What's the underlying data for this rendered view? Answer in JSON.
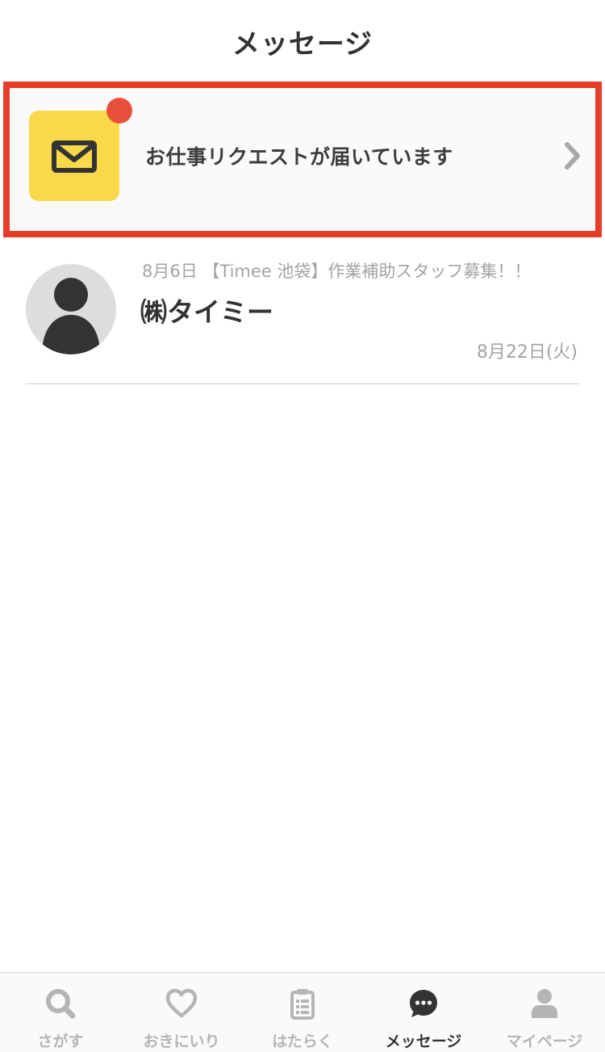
{
  "header": {
    "title": "メッセージ"
  },
  "request_banner": {
    "text": "お仕事リクエストが届いています",
    "has_notification": true,
    "icon": "mail-icon",
    "tile_color": "#f9d84a",
    "dot_color": "#e8503c",
    "highlight_border_color": "#e53d27"
  },
  "threads": [
    {
      "preview": "8月6日 【Timee 池袋】作業補助スタッフ募集！！",
      "sender": "㈱タイミー",
      "date": "8月22日(火)",
      "avatar": "person-avatar-icon"
    }
  ],
  "tabbar": {
    "tabs": [
      {
        "label": "さがす",
        "icon": "search-icon",
        "active": false
      },
      {
        "label": "おきにいり",
        "icon": "heart-icon",
        "active": false
      },
      {
        "label": "はたらく",
        "icon": "clipboard-icon",
        "active": false
      },
      {
        "label": "メッセージ",
        "icon": "chat-bubble-icon",
        "active": true
      },
      {
        "label": "マイページ",
        "icon": "user-icon",
        "active": false
      }
    ],
    "inactive_color": "#b5b5b5",
    "active_color": "#333333"
  }
}
